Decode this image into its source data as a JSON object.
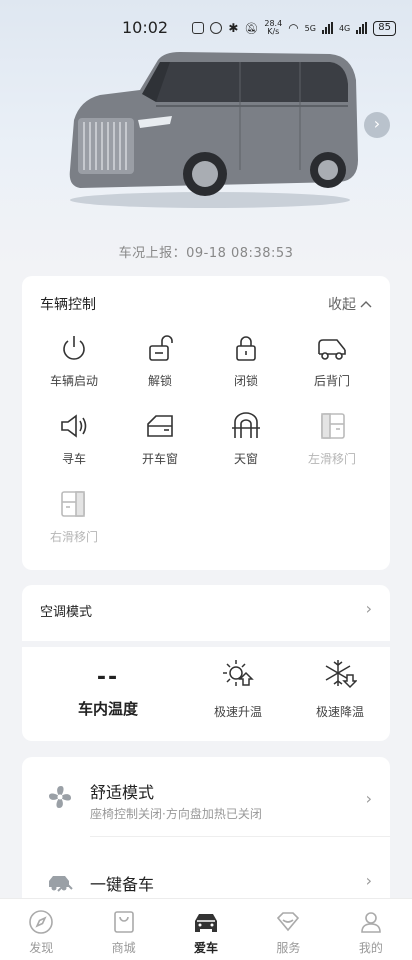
{
  "status_bar": {
    "time": "10:02",
    "net_speed": "28.4",
    "net_unit": "K/s",
    "network_label_1": "5G",
    "network_label_2": "4G",
    "battery": "85"
  },
  "hero": {
    "report_label": "车况上报：",
    "report_time": "09-18 08:38:53",
    "next_icon": "chevron-right-icon"
  },
  "vehicle_control": {
    "title": "车辆控制",
    "collapse_label": "收起",
    "items": [
      {
        "label": "车辆启动",
        "icon": "power-icon",
        "enabled": true
      },
      {
        "label": "解锁",
        "icon": "unlock-icon",
        "enabled": true
      },
      {
        "label": "闭锁",
        "icon": "lock-icon",
        "enabled": true
      },
      {
        "label": "后背门",
        "icon": "tailgate-icon",
        "enabled": true
      },
      {
        "label": "寻车",
        "icon": "horn-icon",
        "enabled": true
      },
      {
        "label": "开车窗",
        "icon": "window-icon",
        "enabled": true
      },
      {
        "label": "天窗",
        "icon": "sunroof-icon",
        "enabled": true
      },
      {
        "label": "左滑移门",
        "icon": "left-sliding-door-icon",
        "enabled": false
      },
      {
        "label": "右滑移门",
        "icon": "right-sliding-door-icon",
        "enabled": false
      }
    ]
  },
  "ac": {
    "title": "空调模式",
    "inside_temp_value": "--",
    "inside_temp_label": "车内温度",
    "heat_label": "极速升温",
    "cool_label": "极速降温"
  },
  "comfort": {
    "mode_title": "舒适模式",
    "mode_subtitle": "座椅控制关闭·方向盘加热已关闭",
    "prep_title": "一键备车"
  },
  "tabs": [
    {
      "label": "发现",
      "icon": "compass-icon",
      "active": false
    },
    {
      "label": "商城",
      "icon": "shopping-bag-icon",
      "active": false
    },
    {
      "label": "爱车",
      "icon": "car-icon",
      "active": true
    },
    {
      "label": "服务",
      "icon": "service-icon",
      "active": false
    },
    {
      "label": "我的",
      "icon": "user-icon",
      "active": false
    }
  ],
  "colors": {
    "background": "#f2f3f6",
    "card": "#ffffff",
    "text_primary": "#222222",
    "text_secondary": "#999999",
    "disabled": "#b6b6b6"
  }
}
